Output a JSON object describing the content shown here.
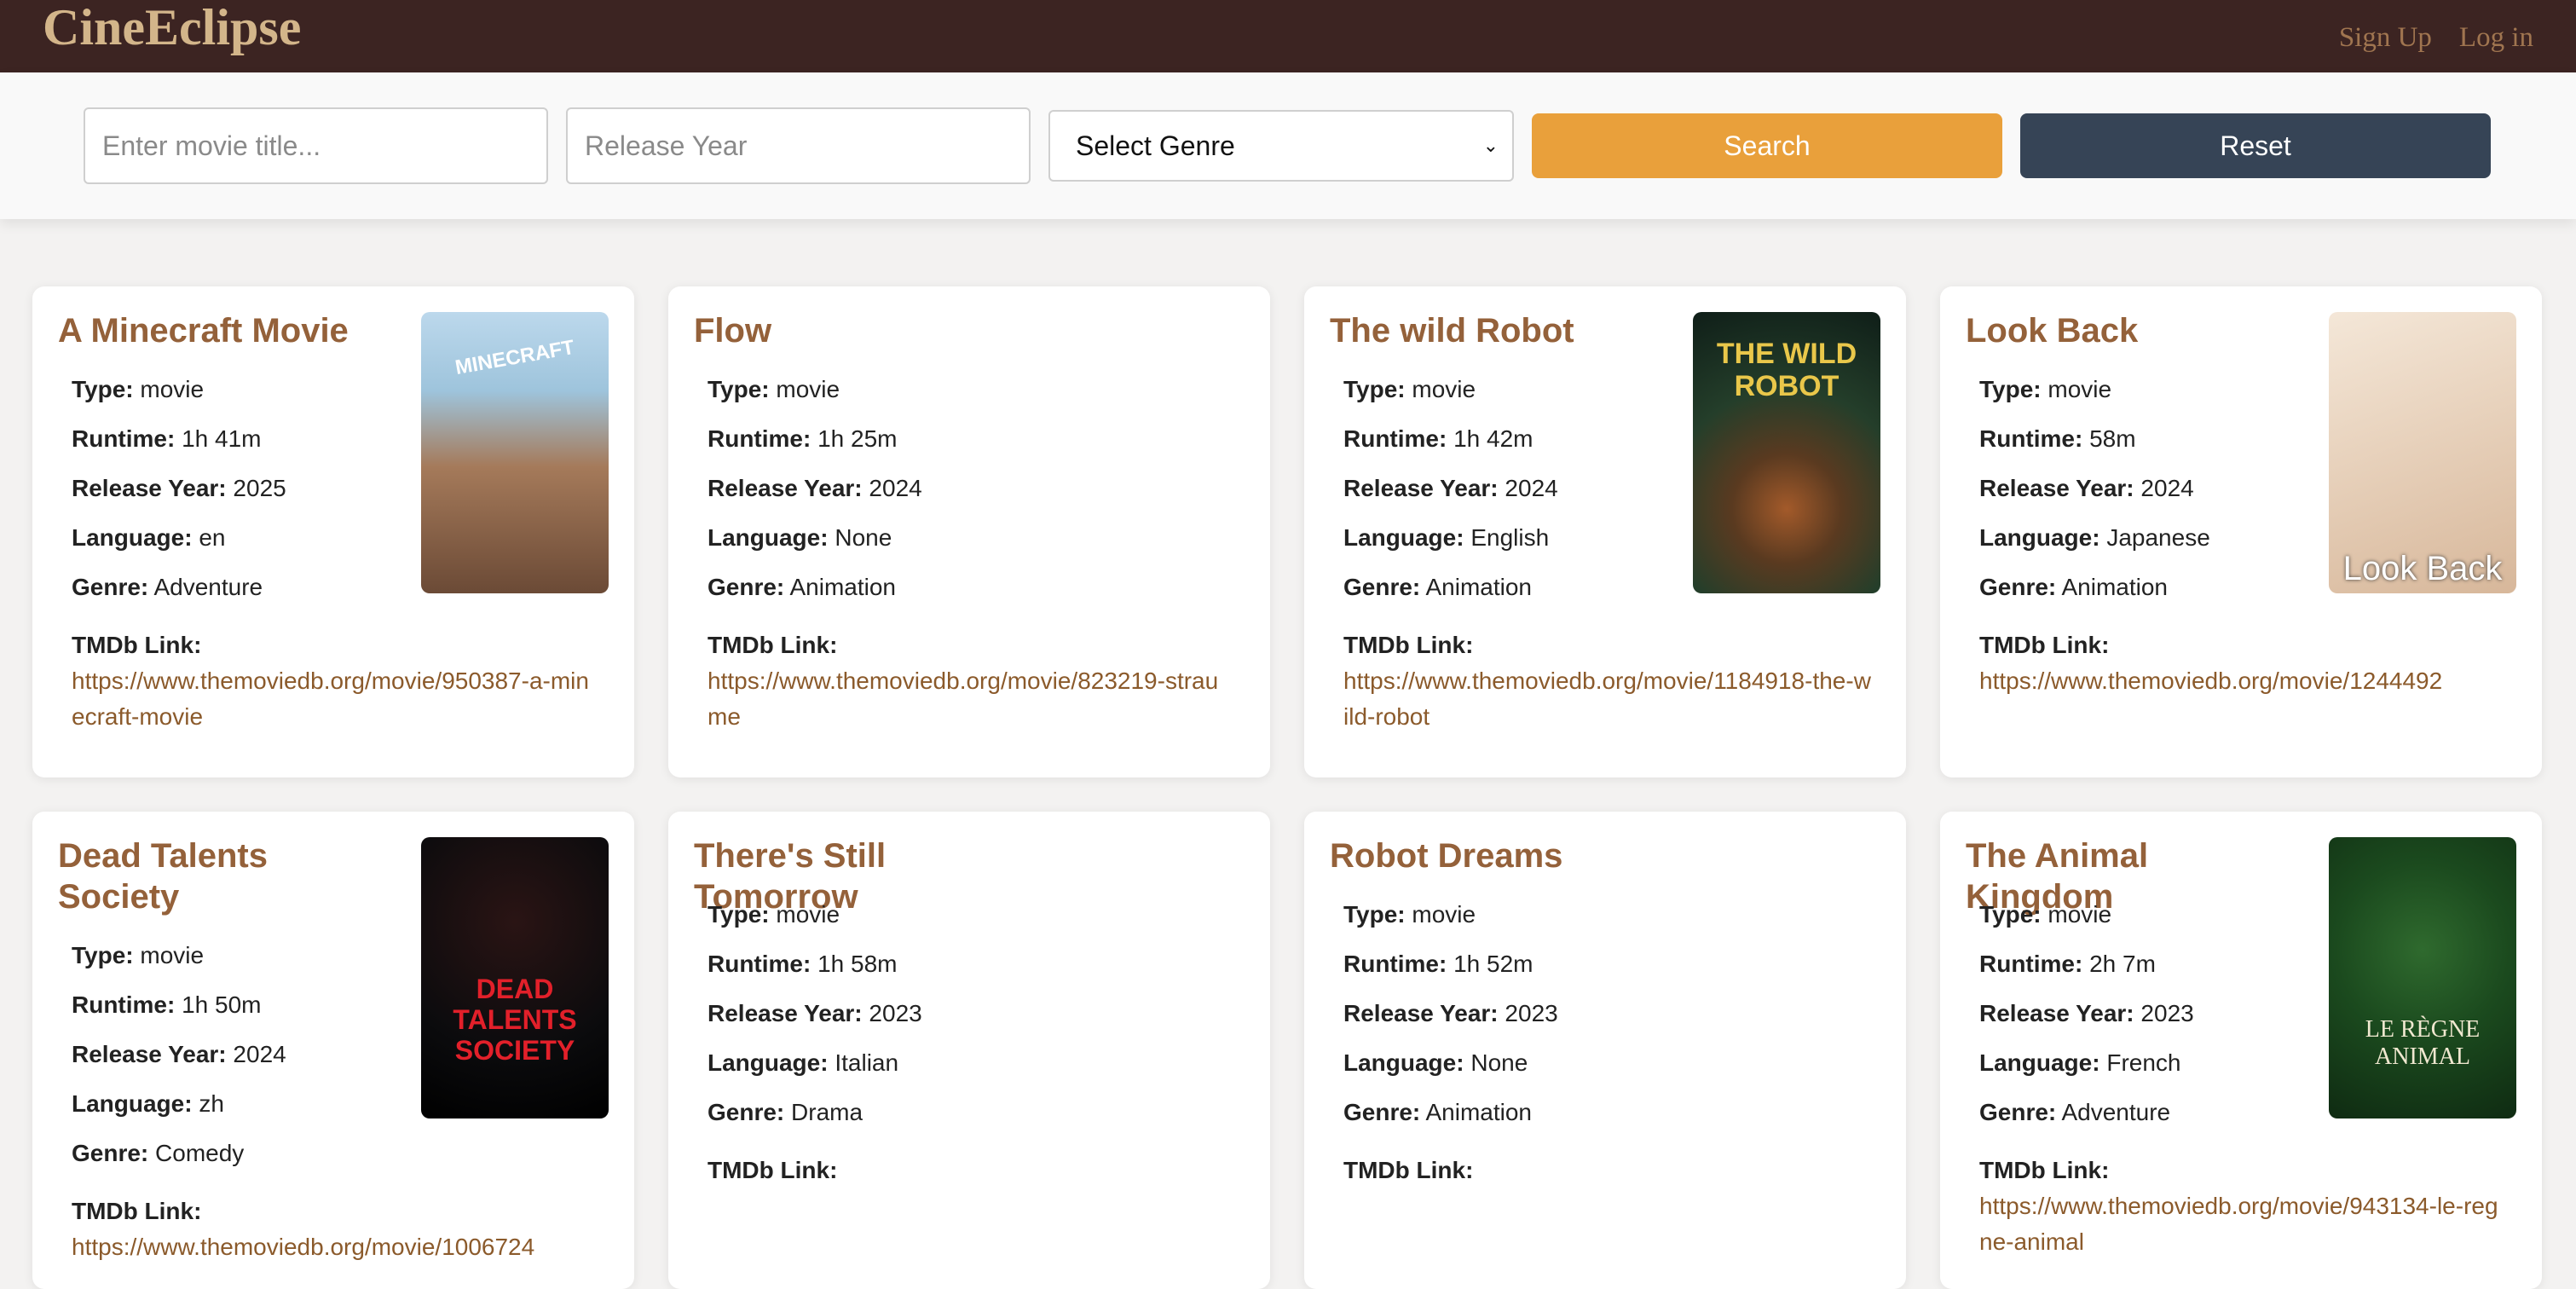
{
  "app": {
    "logo": "CineEclipse",
    "signup_label": "Sign Up",
    "login_label": "Log in"
  },
  "search": {
    "title_placeholder": "Enter movie title...",
    "year_placeholder": "Release Year",
    "genre_selected": "Select Genre",
    "search_label": "Search",
    "reset_label": "Reset"
  },
  "labels": {
    "type": "Type:",
    "runtime": "Runtime:",
    "release_year": "Release Year:",
    "language": "Language:",
    "genre": "Genre:",
    "tmdb": "TMDb Link:"
  },
  "movies": [
    {
      "title": "A Minecraft Movie",
      "type": "movie",
      "runtime": "1h 41m",
      "year": "2025",
      "language": "en",
      "genre": "Adventure",
      "link": "https://www.themoviedb.org/movie/950387-a-minecraft-movie",
      "poster": "minecraft",
      "poster_text": "MINECRAFT"
    },
    {
      "title": "Flow",
      "type": "movie",
      "runtime": "1h 25m",
      "year": "2024",
      "language": "None",
      "genre": "Animation",
      "link": "https://www.themoviedb.org/movie/823219-straume",
      "poster": ""
    },
    {
      "title": "The wild Robot",
      "type": "movie",
      "runtime": "1h 42m",
      "year": "2024",
      "language": "English",
      "genre": "Animation",
      "link": "https://www.themoviedb.org/movie/1184918-the-wild-robot",
      "poster": "wild-robot",
      "poster_text": "THE WILD ROBOT"
    },
    {
      "title": "Look Back",
      "type": "movie",
      "runtime": "58m",
      "year": "2024",
      "language": "Japanese",
      "genre": "Animation",
      "link": "https://www.themoviedb.org/movie/1244492",
      "poster": "look-back",
      "poster_text": "Look Back"
    },
    {
      "title": "Dead Talents Society",
      "type": "movie",
      "runtime": "1h 50m",
      "year": "2024",
      "language": "zh",
      "genre": "Comedy",
      "link": "https://www.themoviedb.org/movie/1006724",
      "poster": "dead-talents",
      "poster_text": "DEAD TALENTS SOCIETY"
    },
    {
      "title": "There's Still Tomorrow",
      "type": "movie",
      "runtime": "1h 58m",
      "year": "2023",
      "language": "Italian",
      "genre": "Drama",
      "link": "",
      "poster": ""
    },
    {
      "title": "Robot Dreams",
      "type": "movie",
      "runtime": "1h 52m",
      "year": "2023",
      "language": "None",
      "genre": "Animation",
      "link": "",
      "poster": ""
    },
    {
      "title": "The Animal Kingdom",
      "type": "movie",
      "runtime": "2h 7m",
      "year": "2023",
      "language": "French",
      "genre": "Adventure",
      "link": "https://www.themoviedb.org/movie/943134-le-regne-animal",
      "poster": "animal-kingdom",
      "poster_text": "LE RÈGNE ANIMAL"
    }
  ]
}
